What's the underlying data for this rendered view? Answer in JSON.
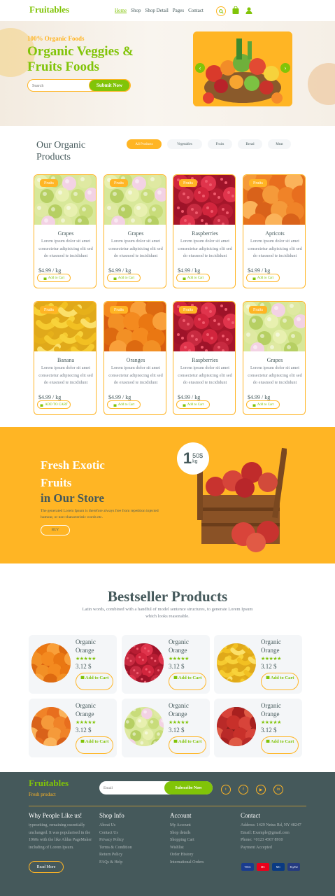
{
  "nav": {
    "logo": "Fruitables",
    "menu": [
      "Home",
      "Shop",
      "Shop Detail",
      "Pages",
      "Contact"
    ],
    "active": "Home"
  },
  "hero": {
    "subtitle": "100% Organic Foods",
    "title": "Organic Veggies & Fruits Foods",
    "search_placeholder": "Search",
    "button": "Submit Now"
  },
  "shop": {
    "title": "Our Organic Products",
    "tabs": [
      "All Products",
      "Vegetables",
      "Fruits",
      "Bread",
      "Meat"
    ],
    "products": [
      {
        "name": "Grapes",
        "category": "Fruits",
        "desc": "Lorem ipsum dolor sit amet consectetur adipisicing elit sed do eiusmod te incididunt",
        "price": "$4.99 / kg",
        "button": "Add to Cart",
        "fruit": "grapes"
      },
      {
        "name": "Grapes",
        "category": "Fruits",
        "desc": "Lorem ipsum dolor sit amet consectetur adipisicing elit sed do eiusmod te incididunt",
        "price": "$4.99 / kg",
        "button": "Add to Cart",
        "fruit": "grapes"
      },
      {
        "name": "Raspberries",
        "category": "Fruits",
        "desc": "Lorem ipsum dolor sit amet consectetur adipisicing elit sed do eiusmod te incididunt",
        "price": "$4.99 / kg",
        "button": "Add to Cart",
        "fruit": "raspberries"
      },
      {
        "name": "Apricots",
        "category": "Fruits",
        "desc": "Lorem ipsum dolor sit amet consectetur adipisicing elit sed do eiusmod te incididunt",
        "price": "$4.99 / kg",
        "button": "Add to Cart",
        "fruit": "apricots"
      },
      {
        "name": "Banana",
        "category": "Fruits",
        "desc": "Lorem ipsum dolor sit amet consectetur adipisicing elit sed do eiusmod te incididunt",
        "price": "$4.99 / kg",
        "button": "ADD TO CART",
        "fruit": "banana"
      },
      {
        "name": "Oranges",
        "category": "Fruits",
        "desc": "Lorem ipsum dolor sit amet consectetur adipisicing elit sed do eiusmod te incididunt",
        "price": "$4.99 / kg",
        "button": "Add to Cart",
        "fruit": "oranges"
      },
      {
        "name": "Raspberries",
        "category": "Fruits",
        "desc": "Lorem ipsum dolor sit amet consectetur adipisicing elit sed do eiusmod te incididunt",
        "price": "$4.99 / kg",
        "button": "Add to Cart",
        "fruit": "raspberries"
      },
      {
        "name": "Grapes",
        "category": "Fruits",
        "desc": "Lorem ipsum dolor sit amet consectetur adipisicing elit sed do eiusmod te incididunt",
        "price": "$4.99 / kg",
        "button": "Add to Cart",
        "fruit": "grapes"
      }
    ]
  },
  "banner": {
    "title_line1": "Fresh Exotic",
    "title_line2": "Fruits",
    "title_line3": "in Our Store",
    "text": "The generated Lorem Ipsum is therefore always free from repetition injected humour, or non-characteristic words etc.",
    "button": "BUY",
    "price_big": "1",
    "price_small": "50$",
    "price_unit": "kg"
  },
  "bestseller": {
    "title": "Bestseller Products",
    "subtitle": "Latin words, combined with a handful of model sentence structures, to generate Lorem Ipsum which looks reasonable.",
    "items": [
      {
        "name": "Organic Orange",
        "stars": "★★★★★",
        "price": "3.12 $",
        "button": "Add to Cart",
        "fruit": "oranges"
      },
      {
        "name": "Organic Orange",
        "stars": "★★★★★",
        "price": "3.12 $",
        "button": "Add to Cart",
        "fruit": "raspberries"
      },
      {
        "name": "Organic Orange",
        "stars": "★★★★★",
        "price": "3.12 $",
        "button": "Add to Cart",
        "fruit": "banana"
      },
      {
        "name": "Organic Orange",
        "stars": "★★★★★",
        "price": "3.12 $",
        "button": "Add to Cart",
        "fruit": "apricots"
      },
      {
        "name": "Organic Orange",
        "stars": "★★★★★",
        "price": "3.12 $",
        "button": "Add to Cart",
        "fruit": "grapes"
      },
      {
        "name": "Organic Orange",
        "stars": "★★★★★",
        "price": "3.12 $",
        "button": "Add to Cart",
        "fruit": "apple"
      }
    ]
  },
  "footer": {
    "logo": "Fruitables",
    "tagline": "Fresh product",
    "search_placeholder": "Email",
    "subscribe": "Subscribe Now",
    "why_title": "Why People Like us!",
    "why_text": "typesetting, remaining essentially unchanged. It was popularised in the 1960s with the like Aldus PageMaker including of Lorem Ipsum.",
    "read_more": "Read More",
    "shop_info_title": "Shop Info",
    "shop_info": [
      "About Us",
      "Contact Us",
      "Privacy Policy",
      "Terms & Condition",
      "Return Policy",
      "FAQs & Help"
    ],
    "account_title": "Account",
    "account": [
      "My Account",
      "Shop details",
      "Shopping Cart",
      "Wishlist",
      "Order History",
      "International Orders"
    ],
    "contact_title": "Contact",
    "contact": [
      "Address: 1429 Netus Rd, NY 48247",
      "Email: Example@gmail.com",
      "Phone: +0123 4567 8910",
      "Payment Accepted"
    ],
    "payments": [
      "VISA",
      "MC",
      "MC",
      "PayPal"
    ]
  },
  "colors": {
    "primary": "#81c408",
    "secondary": "#ffb524",
    "dark": "#45595b"
  }
}
